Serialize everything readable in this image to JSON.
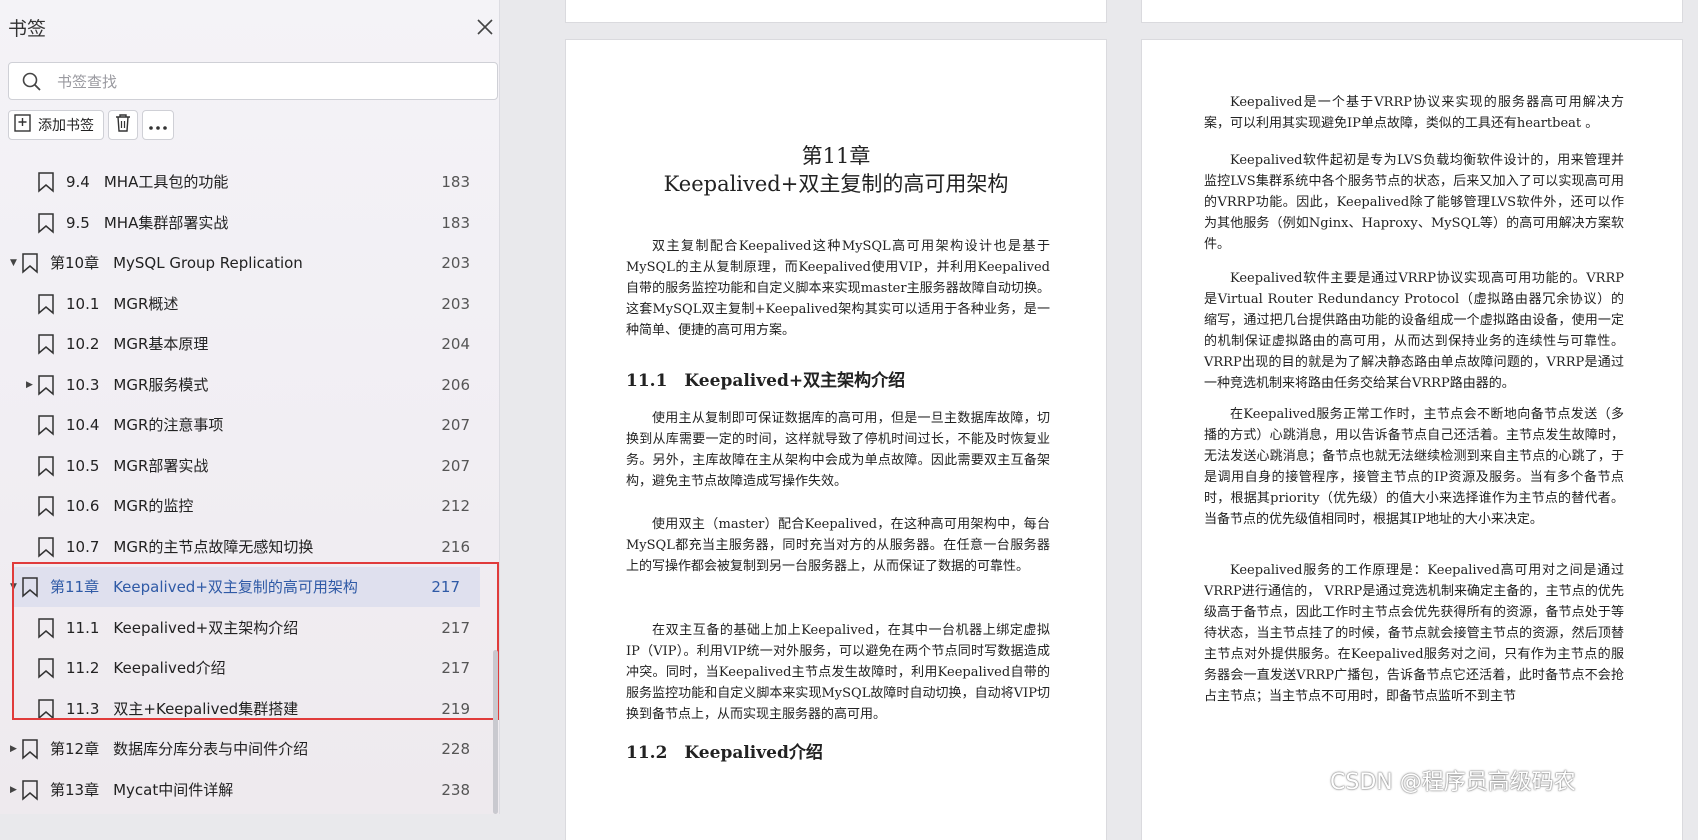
{
  "sidebar": {
    "title": "书签",
    "search_placeholder": "书签查找",
    "add_label": "添加书签",
    "items": [
      {
        "num": "9.4",
        "title": "MHA工具包的功能",
        "page": "183"
      },
      {
        "num": "9.5",
        "title": "MHA集群部署实战",
        "page": "183"
      },
      {
        "num": "第10章",
        "title": "MySQL Group Replication",
        "page": "203"
      },
      {
        "num": "10.1",
        "title": "MGR概述",
        "page": "203"
      },
      {
        "num": "10.2",
        "title": "MGR基本原理",
        "page": "204"
      },
      {
        "num": "10.3",
        "title": "MGR服务模式",
        "page": "206"
      },
      {
        "num": "10.4",
        "title": "MGR的注意事项",
        "page": "207"
      },
      {
        "num": "10.5",
        "title": "MGR部署实战",
        "page": "207"
      },
      {
        "num": "10.6",
        "title": "MGR的监控",
        "page": "212"
      },
      {
        "num": "10.7",
        "title": "MGR的主节点故障无感知切换",
        "page": "216"
      },
      {
        "num": "第11章",
        "title": "Keepalived+双主复制的高可用架构",
        "page": "217"
      },
      {
        "num": "11.1",
        "title": "Keepalived+双主架构介绍",
        "page": "217"
      },
      {
        "num": "11.2",
        "title": "Keepalived介绍",
        "page": "217"
      },
      {
        "num": "11.3",
        "title": "双主+Keepalived集群搭建",
        "page": "219"
      },
      {
        "num": "第12章",
        "title": "数据库分库分表与中间件介绍",
        "page": "228"
      },
      {
        "num": "第13章",
        "title": "Mycat中间件详解",
        "page": "238"
      }
    ]
  },
  "left_page": {
    "chapter_no": "第11章",
    "chapter_title": "Keepalived+双主复制的高可用架构",
    "intro": "双主复制配合Keepalived这种MySQL高可用架构设计也是基于MySQL的主从复制原理，而Keepalived使用VIP，并利用Keepalived自带的服务监控功能和自定义脚本来实现master主服务器故障自动切换。这套MySQL双主复制+Keepalived架构其实可以适用于各种业务，是一种简单、便捷的高可用方案。",
    "sec1": "11.1　Keepalived+双主架构介绍",
    "p1": "使用主从复制即可保证数据库的高可用，但是一旦主数据库故障，切换到从库需要一定的时间，这样就导致了停机时间过长，不能及时恢复业务。另外，主库故障在主从架构中会成为单点故障。因此需要双主互备架构，避免主节点故障造成写操作失效。",
    "p2": "使用双主（master）配合Keepalived，在这种高可用架构中，每台MySQL都充当主服务器，同时充当对方的从服务器。在任意一台服务器上的写操作都会被复制到另一台服务器上，从而保证了数据的可靠性。",
    "p3": "在双主互备的基础上加上Keepalived，在其中一台机器上绑定虚拟IP（VIP）。利用VIP统一对外服务，可以避免在两个节点同时写数据造成冲突。同时，当Keepalived主节点发生故障时，利用Keepalived自带的服务监控功能和自定义脚本来实现MySQL故障时自动切换，自动将VIP切换到备节点上，从而实现主服务器的高可用。",
    "sec2": "11.2　Keepalived介绍"
  },
  "right_page": {
    "p1": "Keepalived是一个基于VRRP协议来实现的服务器高可用解决方案，可以利用其实现避免IP单点故障，类似的工具还有heartbeat 。",
    "p2": "Keepalived软件起初是专为LVS负载均衡软件设计的，用来管理并监控LVS集群系统中各个服务节点的状态，后来又加入了可以实现高可用的VRRP功能。因此，Keepalived除了能够管理LVS软件外，还可以作为其他服务（例如Nginx、Haproxy、MySQL等）的高可用解决方案软件。",
    "p3": "Keepalived软件主要是通过VRRP协议实现高可用功能的。VRRP是Virtual Router Redundancy Protocol（虚拟路由器冗余协议）的缩写，通过把几台提供路由功能的设备组成一个虚拟路由设备，使用一定的机制保证虚拟路由的高可用，从而达到保持业务的连续性与可靠性。VRRP出现的目的就是为了解决静态路由单点故障问题的，VRRP是通过一种竞选机制来将路由任务交给某台VRRP路由器的。",
    "p4": "在Keepalived服务正常工作时，主节点会不断地向备节点发送（多播的方式）心跳消息，用以告诉备节点自己还活着。主节点发生故障时，无法发送心跳消息；备节点也就无法继续检测到来自主节点的心跳了，于是调用自身的接管程序，接管主节点的IP资源及服务。当有多个备节点时，根据其priority（优先级）的值大小来选择谁作为主节点的替代者。当备节点的优先级值相同时，根据其IP地址的大小来决定。",
    "p5": "Keepalived服务的工作原理是：Keepalived高可用对之间是通过VRRP进行通信的， VRRP是通过竞选机制来确定主备的，主节点的优先级高于备节点，因此工作时主节点会优先获得所有的资源，备节点处于等待状态，当主节点挂了的时候，备节点就会接管主节点的资源，然后顶替主节点对外提供服务。在Keepalived服务对之间，只有作为主节点的服务器会一直发送VRRP广播包，告诉备节点它还活着，此时备节点不会抢占主节点；当主节点不可用时，即备节点监听不到主节"
  },
  "watermark": "CSDN @程序员高级码农",
  "colors": {
    "selected_text": "#2f5aa6",
    "highlight_border": "#e03b3b",
    "selected_bg": "#dfe0ee"
  }
}
